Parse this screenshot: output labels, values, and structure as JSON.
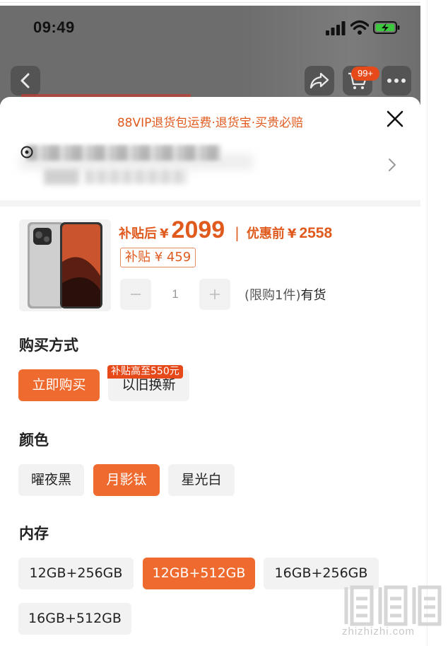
{
  "status_bar": {
    "time": "09:49",
    "signal_icon": "cellular-signal-icon",
    "wifi_icon": "wifi-icon",
    "battery_icon": "battery-charging-icon"
  },
  "nav": {
    "back_icon": "chevron-left-icon",
    "share_icon": "share-icon",
    "cart_icon": "cart-icon",
    "cart_badge": "99+",
    "more_icon": "more-icon"
  },
  "sheet": {
    "vip_banner": "88VIP退货包运费·退货宝·买贵必赔",
    "close_icon": "close-icon",
    "address_chevron_icon": "chevron-right-icon"
  },
  "product": {
    "subsidy_label": "补贴后",
    "currency": "¥",
    "subsidy_price": "2099",
    "separator": "|",
    "original_label": "优惠前",
    "original_price": "2558",
    "subsidy_tag": "补贴 ¥ 459",
    "quantity": "1",
    "limit_text": "(限购1件)",
    "stock_text": "有货"
  },
  "purchase_method": {
    "title": "购买方式",
    "options": [
      "立即购买",
      "以旧换新"
    ],
    "selected": "立即购买",
    "promo_badge": "补贴高至550元"
  },
  "color": {
    "title": "颜色",
    "options": [
      "曜夜黑",
      "月影钛",
      "星光白"
    ],
    "selected": "月影钛"
  },
  "memory": {
    "title": "内存",
    "options": [
      "12GB+256GB",
      "12GB+512GB",
      "16GB+256GB",
      "16GB+512GB"
    ],
    "selected": "12GB+512GB"
  },
  "watermark": {
    "site": "zhizhizhi.com"
  },
  "colors": {
    "accent": "#ef6a2f",
    "price": "#e05a1e",
    "badge": "#e64a1a"
  }
}
